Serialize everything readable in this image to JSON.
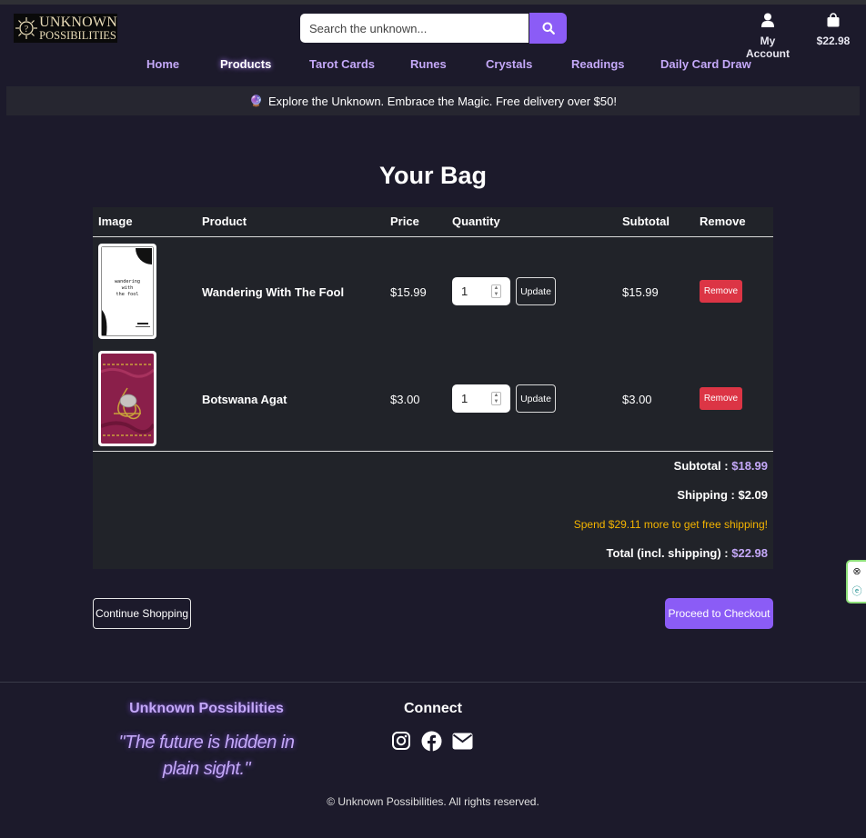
{
  "header": {
    "logo_line1": "UNKNOWN",
    "logo_line2": "POSSIBILITIES",
    "search_placeholder": "Search the unknown...",
    "account_label": "My Account",
    "cart_total": "$22.98"
  },
  "nav": {
    "items": [
      "Home",
      "Products",
      "Tarot Cards",
      "Runes",
      "Crystals",
      "Readings",
      "Daily Card Draw"
    ],
    "active": "Products"
  },
  "banner": {
    "text": "Explore the Unknown. Embrace the Magic. Free delivery over $50!"
  },
  "page_title": "Your Bag",
  "table": {
    "headers": [
      "Image",
      "Product",
      "Price",
      "Quantity",
      "Subtotal",
      "Remove"
    ],
    "rows": [
      {
        "product": "Wandering With The Fool",
        "price": "$15.99",
        "quantity": "1",
        "subtotal": "$15.99",
        "update_label": "Update",
        "remove_label": "Remove",
        "thumb_title": "wandering with the fool"
      },
      {
        "product": "Botswana Agat",
        "price": "$3.00",
        "quantity": "1",
        "subtotal": "$3.00",
        "update_label": "Update",
        "remove_label": "Remove"
      }
    ]
  },
  "summary": {
    "subtotal_label": "Subtotal :",
    "subtotal_value": "$18.99",
    "shipping_label": "Shipping : $2.09",
    "free_shipping_note": "Spend $29.11 more to get free shipping!",
    "total_label": "Total (incl. shipping) :",
    "total_value": "$22.98"
  },
  "actions": {
    "continue_label": "Continue Shopping",
    "checkout_label": "Proceed to Checkout"
  },
  "footer": {
    "brand": "Unknown Possibilities",
    "quote": "\"The future is hidden in plain sight.\"",
    "connect_label": "Connect",
    "copyright": "© Unknown Possibilities. All rights reserved."
  },
  "colors": {
    "accent": "#8b5cf6",
    "nav_link": "#c4a8f8",
    "remove": "#dc3545",
    "warning": "#f4b400",
    "background": "#1c1a2b"
  }
}
